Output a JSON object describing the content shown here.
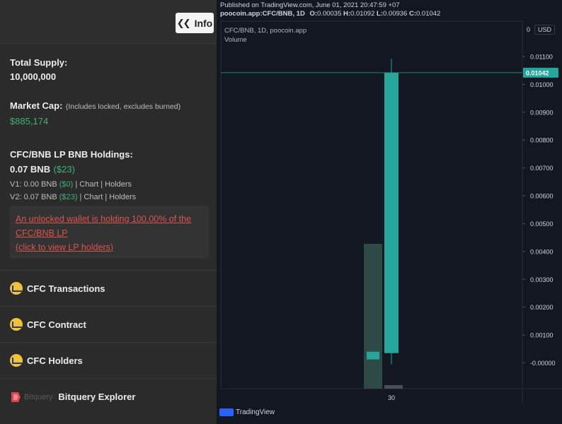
{
  "panel": {
    "info_button": "Info",
    "total_supply_label": "Total Supply:",
    "total_supply_value": "10,000,000",
    "market_cap_label": "Market Cap:",
    "market_cap_note": "(Includes locked, excludes burned)",
    "market_cap_value": "$885,174",
    "lp_label": "CFC/BNB LP BNB Holdings:",
    "lp_value": "0.07 BNB",
    "lp_usd": "($23)",
    "v1_prefix": "V1: 0.00 BNB",
    "v1_usd": "($0)",
    "v2_prefix": "V2: 0.07 BNB",
    "v2_usd": "($23)",
    "chart_link": "Chart",
    "holders_link": "Holders",
    "pipe": "|",
    "warning_line1": "An unlocked wallet is holding 100.00% of the",
    "warning_line2": "CFC/BNB LP",
    "warning_line3": "(click to view LP holders)",
    "nav": [
      "CFC Transactions",
      "CFC Contract",
      "CFC Holders"
    ],
    "bitquery_logo_text": "Bitquery",
    "bitquery_label": "Bitquery Explorer"
  },
  "tradingview": {
    "published": "Published on TradingView.com, June 01, 2021 20:47:59 +07",
    "symbol": "poocoin.app:CFC/BNB, 1D",
    "o_label": "O:",
    "o_value": "0.00035",
    "h_label": "H:",
    "h_value": "0.01092",
    "l_label": "L:",
    "l_value": "0.00936",
    "c_label": "C:",
    "c_value": "0.01042",
    "legend_title": "CFC/BNB, 1D, poocoin.app",
    "legend_volume": "Volume",
    "currency": "USD",
    "currency_zero": "0",
    "footer": "TradingView",
    "colors": {
      "up": "#26a69a",
      "up_dim": "#2d4a44",
      "price_tag": "#26a69a",
      "bg": "#131722"
    }
  },
  "chart_data": {
    "type": "candlestick",
    "x_tick": "30",
    "yticks": [
      "0.01100",
      "0.01000",
      "0.00900",
      "0.00800",
      "0.00700",
      "0.00600",
      "0.00500",
      "0.00400",
      "0.00300",
      "0.00200",
      "0.00100",
      "-0.00000"
    ],
    "ytick_values": [
      0.011,
      0.01,
      0.009,
      0.008,
      0.007,
      0.006,
      0.005,
      0.004,
      0.003,
      0.002,
      0.001,
      0.0
    ],
    "ylim": [
      -0.0011,
      0.0117
    ],
    "last_price_label": "0.01042",
    "last_price": 0.01042,
    "candles": [
      {
        "open": 0.00035,
        "high": 0.01092,
        "low": -5e-05,
        "close": 0.01042,
        "day": "30"
      }
    ],
    "small_candle": {
      "open": 0.0004,
      "close": 0.0002
    },
    "volume": [
      {
        "value": 0.82,
        "dim": true
      },
      {
        "value": 0.02,
        "dim": false
      }
    ]
  }
}
